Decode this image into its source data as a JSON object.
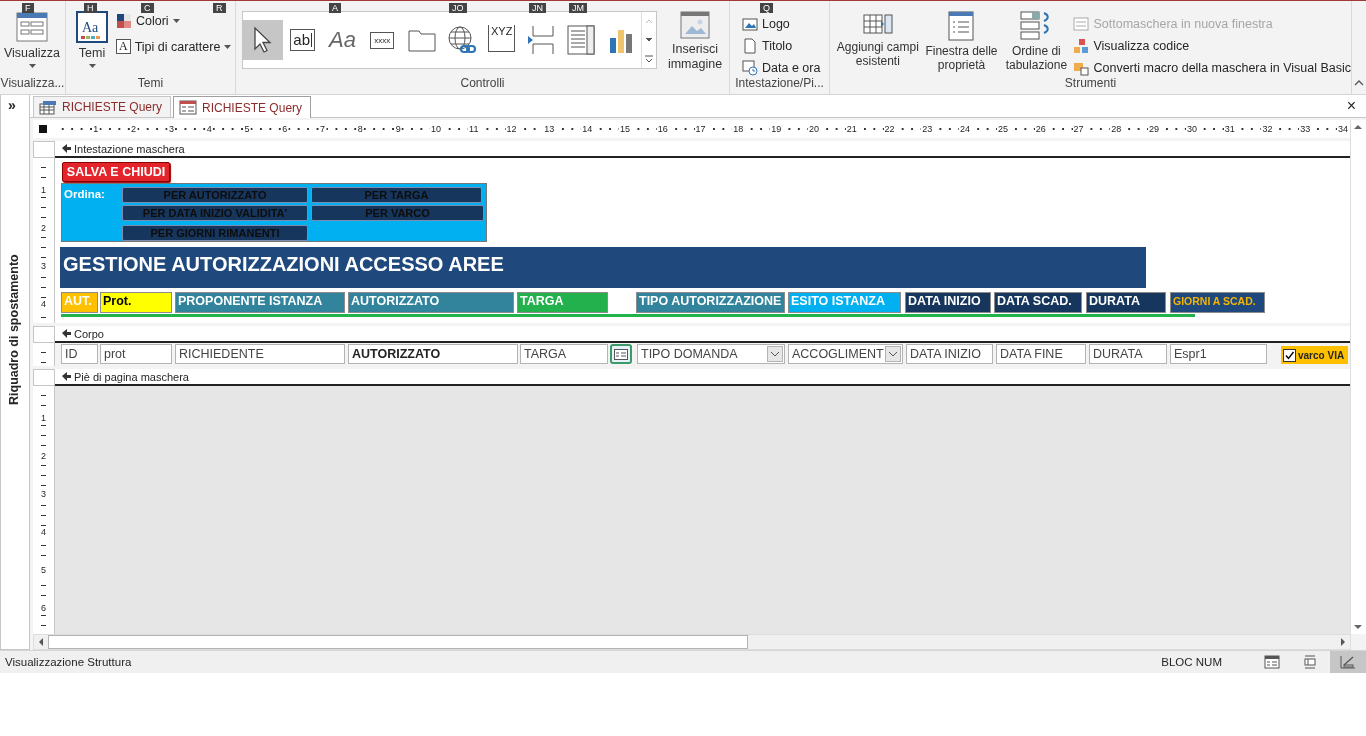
{
  "ribbon": {
    "view_group": {
      "label": "Visualizza...",
      "button": {
        "label": "Visualizza",
        "keytip": "F"
      }
    },
    "themes_group": {
      "label": "Temi",
      "keytip": "R",
      "themes": {
        "label": "Temi",
        "keytip": "H",
        "glyph": "Aa"
      },
      "colors": {
        "label": "Colori",
        "keytip": "C"
      },
      "fonts": {
        "label": "Tipi di carattere",
        "glyph": "A"
      }
    },
    "controls_group": {
      "label": "Controlli",
      "tools": [
        {
          "kind": "pointer",
          "selected": true
        },
        {
          "kind": "textbox",
          "glyph": "ab",
          "selected": false
        },
        {
          "kind": "label",
          "glyph": "Aa",
          "selected": false,
          "keytip": "A"
        },
        {
          "kind": "button",
          "glyph": "xxxx",
          "selected": false
        },
        {
          "kind": "tab",
          "selected": false
        },
        {
          "kind": "hyperlink",
          "selected": false,
          "keytip": "JO"
        },
        {
          "kind": "frame",
          "glyph": "XYZ",
          "selected": false
        },
        {
          "kind": "pagebreak",
          "selected": false,
          "keytip": "JN"
        },
        {
          "kind": "listbox",
          "selected": false,
          "keytip": "JM"
        },
        {
          "kind": "chart",
          "selected": false
        }
      ],
      "insert_image": {
        "label": "Inserisci immagine"
      }
    },
    "header_group": {
      "label": "Intestazione/Pi...",
      "keytip": "Q",
      "items": [
        {
          "kind": "logo",
          "label": "Logo"
        },
        {
          "kind": "title",
          "label": "Titolo"
        },
        {
          "kind": "datetime",
          "label": "Data e ora"
        }
      ]
    },
    "tools_group": {
      "label": "Strumenti",
      "large": [
        {
          "kind": "fields",
          "label": "Aggiungi campi esistenti"
        },
        {
          "kind": "properties",
          "label": "Finestra delle proprietà"
        },
        {
          "kind": "taborder",
          "label": "Ordine di tabulazione"
        }
      ],
      "small": [
        {
          "kind": "subform",
          "label": "Sottomaschera in nuova finestra",
          "disabled": true
        },
        {
          "kind": "code",
          "label": "Visualizza codice",
          "disabled": false
        },
        {
          "kind": "convert",
          "label": "Converti macro della maschera in Visual Basic",
          "disabled": false
        }
      ]
    }
  },
  "nav_pane": {
    "title": "Riquadro di spostamento",
    "toggle": "»"
  },
  "document_tabs": [
    {
      "label": "RICHIESTE Query",
      "kind": "datasheet",
      "selected": false
    },
    {
      "label": "RICHIESTE Query",
      "kind": "form",
      "selected": true
    }
  ],
  "close": "×",
  "ruler": {
    "marks": [
      "1",
      "2",
      "3",
      "4",
      "5",
      "6",
      "7",
      "8",
      "9",
      "10",
      "11",
      "12",
      "13",
      "14",
      "15",
      "16",
      "17",
      "18",
      "19",
      "20",
      "21",
      "22",
      "23",
      "24",
      "25",
      "26",
      "27",
      "28",
      "29",
      "30",
      "31",
      "32",
      "33",
      "34"
    ]
  },
  "form": {
    "header": {
      "title": "Intestazione maschera",
      "ruler_marks": [
        "1",
        "2",
        "3",
        "4"
      ],
      "save_button": "SALVA E CHIUDI",
      "sort_panel": {
        "label": "Ordina:",
        "buttons": [
          "PER AUTORIZZATO",
          "PER TARGA",
          "PER DATA INIZIO VALIDITA'",
          "PER VARCO",
          "PER GIORNI RIMANENTI"
        ]
      },
      "banner": "GESTIONE AUTORIZZAZIONI ACCESSO AREE",
      "column_labels": [
        {
          "text": "AUT.",
          "color": "#ffc000"
        },
        {
          "text": "Prot.",
          "color": "#ffff00"
        },
        {
          "text": "PROPONENTE ISTANZA",
          "color": "#31849b"
        },
        {
          "text": "AUTORIZZATO",
          "color": "#31849b"
        },
        {
          "text": "TARGA",
          "color": "#22b14c"
        },
        {
          "text": "TIPO AUTORIZZAZIONE",
          "color": "#31849b"
        },
        {
          "text": "ESITO ISTANZA",
          "color": "#00b0f0"
        },
        {
          "text": "DATA INIZIO",
          "color": "#17365d"
        },
        {
          "text": "DATA SCAD.",
          "color": "#17365d"
        },
        {
          "text": "DURATA",
          "color": "#17365d"
        },
        {
          "text": "GIORNI A SCAD.",
          "color": "#1f497d",
          "kind": "accent"
        }
      ]
    },
    "detail": {
      "title": "Corpo",
      "controls": [
        {
          "kind": "text",
          "value": "ID"
        },
        {
          "kind": "text",
          "value": "prot"
        },
        {
          "kind": "text",
          "value": "RICHIEDENTE"
        },
        {
          "kind": "text",
          "value": "AUTORIZZATO",
          "bold": true
        },
        {
          "kind": "text",
          "value": "TARGA"
        },
        {
          "kind": "button"
        },
        {
          "kind": "combo",
          "value": "TIPO DOMANDA"
        },
        {
          "kind": "combo",
          "value": "ACCOGLIMENT"
        },
        {
          "kind": "text",
          "value": "DATA INIZIO"
        },
        {
          "kind": "text",
          "value": "DATA FINE"
        },
        {
          "kind": "text",
          "value": "DURATA"
        },
        {
          "kind": "text",
          "value": "Espr1"
        },
        {
          "kind": "check",
          "checked": true,
          "label": "varco VIA"
        }
      ]
    },
    "footer": {
      "title": "Piè di pagina maschera",
      "ruler_marks": [
        "1",
        "2",
        "3",
        "4",
        "5",
        "6"
      ]
    }
  },
  "status_bar": {
    "text": "Visualizzazione Struttura",
    "indicator": "BLOC NUM",
    "views": [
      {
        "kind": "form",
        "selected": false
      },
      {
        "kind": "layout",
        "selected": false
      },
      {
        "kind": "design",
        "selected": true
      }
    ]
  }
}
